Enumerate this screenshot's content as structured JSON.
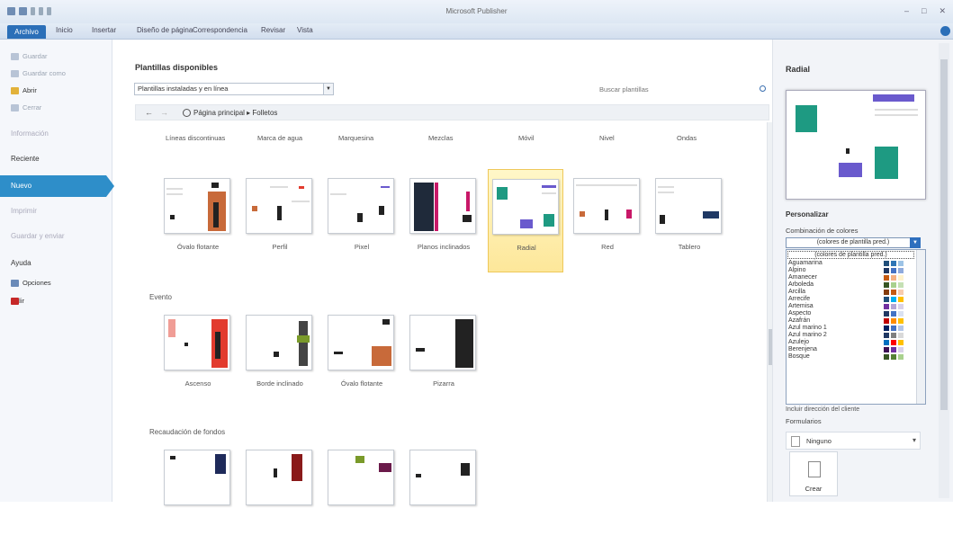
{
  "window": {
    "title": "Microsoft Publisher"
  },
  "ribbon": {
    "tabs": [
      {
        "label": "Archivo",
        "active": true
      },
      {
        "label": "Inicio"
      },
      {
        "label": "Insertar"
      },
      {
        "label": "Diseño de página"
      },
      {
        "label": "Correspondencia"
      },
      {
        "label": "Revisar"
      },
      {
        "label": "Vista"
      }
    ]
  },
  "backstage_nav": {
    "items": [
      {
        "label": "Guardar"
      },
      {
        "label": "Guardar como"
      },
      {
        "label": "Abrir"
      },
      {
        "label": "Cerrar"
      },
      {
        "label": "Información"
      },
      {
        "label": "Reciente"
      },
      {
        "label": "Nuevo"
      },
      {
        "label": "Imprimir"
      },
      {
        "label": "Guardar y enviar"
      },
      {
        "label": "Ayuda"
      },
      {
        "label": "Opciones"
      },
      {
        "label": "Salir"
      }
    ]
  },
  "main": {
    "title": "Plantillas disponibles",
    "filter_value": "Plantillas instaladas y en línea",
    "search_placeholder": "Buscar plantillas",
    "breadcrumb": "Página principal ▸ Folletos",
    "design_categories": [
      "Líneas discontinuas",
      "Marca de agua",
      "Marquesina",
      "Mezclas",
      "Móvil",
      "Nivel",
      "Ondas"
    ],
    "sections": [
      {
        "label": "",
        "templates": [
          {
            "label": "Óvalo flotante"
          },
          {
            "label": "Perfil"
          },
          {
            "label": "Pixel"
          },
          {
            "label": "Planos inclinados"
          },
          {
            "label": "Radial",
            "selected": true
          },
          {
            "label": "Red"
          },
          {
            "label": "Tablero"
          }
        ]
      },
      {
        "label": "Evento",
        "templates": [
          {
            "label": "Ascenso"
          },
          {
            "label": "Borde inclinado"
          },
          {
            "label": "Óvalo flotante"
          },
          {
            "label": "Pizarra"
          }
        ]
      },
      {
        "label": "Recaudación de fondos",
        "templates": [
          {
            "label": ""
          },
          {
            "label": ""
          },
          {
            "label": ""
          },
          {
            "label": ""
          }
        ]
      }
    ]
  },
  "right_pane": {
    "title": "Radial",
    "customize_heading": "Personalizar",
    "color_scheme_label": "Combinación de colores",
    "color_scheme_value": "(colores de plantilla pred.)",
    "color_scheme_options": [
      {
        "label": "(colores de plantilla pred.)"
      },
      {
        "label": "Aguamarina",
        "colors": [
          "#1f4e79",
          "#2e75b6",
          "#9dc3e6"
        ]
      },
      {
        "label": "Alpino",
        "colors": [
          "#1f3864",
          "#4472c4",
          "#8faadc"
        ]
      },
      {
        "label": "Amanecer",
        "colors": [
          "#c55a11",
          "#f4b183",
          "#fff2cc"
        ]
      },
      {
        "label": "Arboleda",
        "colors": [
          "#375623",
          "#a9d18e",
          "#c5e0b4"
        ]
      },
      {
        "label": "Arcilla",
        "colors": [
          "#843c0c",
          "#c55a11",
          "#f8cbad"
        ]
      },
      {
        "label": "Arrecife",
        "colors": [
          "#1f4e79",
          "#00b0f0",
          "#ffc000"
        ]
      },
      {
        "label": "Artemisa",
        "colors": [
          "#7030a0",
          "#b4a7d6",
          "#d9d2e9"
        ]
      },
      {
        "label": "Aspecto",
        "colors": [
          "#203864",
          "#4472c4",
          "#d9e1f2"
        ]
      },
      {
        "label": "Azafrán",
        "colors": [
          "#c00000",
          "#ff8c00",
          "#ffc000"
        ]
      },
      {
        "label": "Azul marino 1",
        "colors": [
          "#002060",
          "#4472c4",
          "#b4c6e7"
        ]
      },
      {
        "label": "Azul marino 2",
        "colors": [
          "#1f3864",
          "#7f7f7f",
          "#d9d9d9"
        ]
      },
      {
        "label": "Azulejo",
        "colors": [
          "#0070c0",
          "#ff0000",
          "#ffc000"
        ]
      },
      {
        "label": "Berenjena",
        "colors": [
          "#3c1053",
          "#7030a0",
          "#d9d2e9"
        ]
      },
      {
        "label": "Bosque",
        "colors": [
          "#375623",
          "#548235",
          "#a9d18e"
        ]
      }
    ],
    "font_scheme_partial": "Incluir dirección del cliente",
    "form_label": "Formularios",
    "form_value": "Ninguno",
    "create_label": "Crear"
  }
}
